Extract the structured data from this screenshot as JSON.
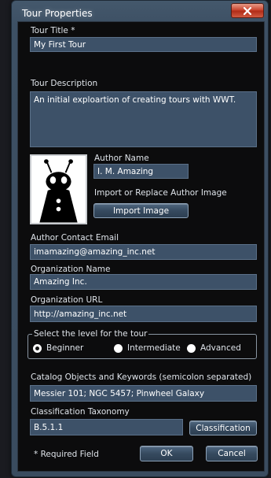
{
  "window": {
    "title": "Tour Properties",
    "close_icon": "close-icon"
  },
  "tour_title": {
    "label": "Tour Title *",
    "value": "My First Tour"
  },
  "tour_description": {
    "label": "Tour Description",
    "value": "An initial exploartion of creating tours with WWT."
  },
  "author": {
    "name_label": "Author Name",
    "name_value": "I. M. Amazing",
    "image_label": "Import or Replace Author Image",
    "import_button": "Import Image",
    "avatar_icon": "alien-avatar-icon"
  },
  "contact_email": {
    "label": "Author Contact Email",
    "value": "imamazing@amazing_inc.net"
  },
  "organization_name": {
    "label": "Organization Name",
    "value": "Amazing Inc."
  },
  "organization_url": {
    "label": "Organization URL",
    "value": "http://amazing_inc.net"
  },
  "level": {
    "legend": "Select the level for the tour",
    "options": [
      {
        "label": "Beginner",
        "selected": true
      },
      {
        "label": "Intermediate",
        "selected": false
      },
      {
        "label": "Advanced",
        "selected": false
      }
    ]
  },
  "keywords": {
    "label": "Catalog Objects and Keywords (semicolon separated)",
    "value": "Messier 101; NGC 5457; Pinwheel Galaxy"
  },
  "taxonomy": {
    "label": "Classification Taxonomy",
    "value": "B.5.1.1",
    "button": "Classification"
  },
  "footer": {
    "required_note": "* Required Field",
    "ok_button": "OK",
    "cancel_button": "Cancel"
  },
  "colors": {
    "field_bg": "#3d5168",
    "window_frame": "#44586c",
    "close_red": "#c8412a",
    "client_bg": "#0c0c0d"
  }
}
